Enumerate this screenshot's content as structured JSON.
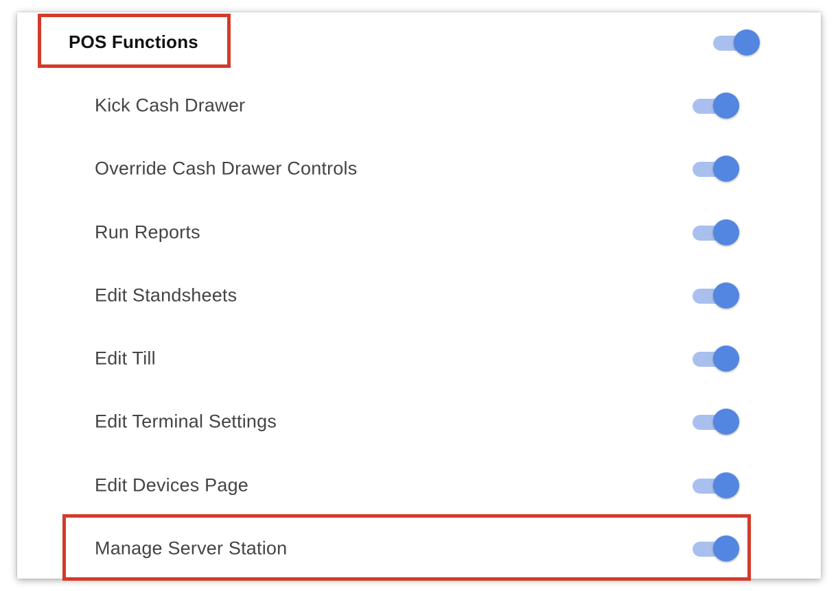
{
  "section": {
    "title": "POS Functions",
    "enabled": true
  },
  "permissions": [
    {
      "label": "Kick Cash Drawer",
      "enabled": true
    },
    {
      "label": "Override Cash Drawer Controls",
      "enabled": true
    },
    {
      "label": "Run Reports",
      "enabled": true
    },
    {
      "label": "Edit Standsheets",
      "enabled": true
    },
    {
      "label": "Edit Till",
      "enabled": true
    },
    {
      "label": "Edit Terminal Settings",
      "enabled": true
    },
    {
      "label": "Edit Devices Page",
      "enabled": true
    },
    {
      "label": "Manage Server Station",
      "enabled": true
    }
  ],
  "colors": {
    "toggle_track_on": "#a9c0ef",
    "toggle_knob_on": "#5286e0",
    "highlight": "#d23b2a"
  }
}
